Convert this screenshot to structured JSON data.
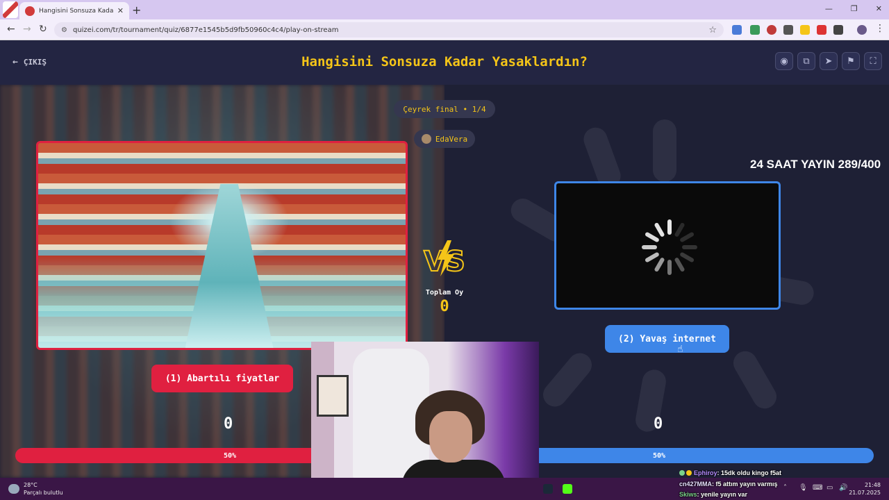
{
  "browser": {
    "tab_title": "Hangisini Sonsuza Kadar Yasaklardın",
    "url": "quizei.com/tr/tournament/quiz/6877e1545b5d9fb50960c4c4/play-on-stream"
  },
  "header": {
    "exit_label": "ÇIKIŞ",
    "title": "Hangisini Sonsuza Kadar Yasaklardın?"
  },
  "stage": {
    "round_label": "Çeyrek final • 1/4",
    "creator": "EdaVera",
    "total_votes_label": "Toplam Oy",
    "total_votes": "0",
    "stream_title": "24 SAAT YAYIN 289/400"
  },
  "options": [
    {
      "label": "(1) Abartılı fiyatlar",
      "votes": "0",
      "percent_label": "50%",
      "percent": 50,
      "color": "#e02040"
    },
    {
      "label": "(2) Yavaş internet",
      "votes": "0",
      "percent_label": "50%",
      "percent": 50,
      "color": "#3e86e8"
    }
  ],
  "taskbar": {
    "temperature": "28°C",
    "weather": "Parçalı bulutlu",
    "time": "21:48",
    "date": "21.07.2025"
  },
  "chat": [
    {
      "user": "Ephiroy",
      "message": ": 15dk oldu kingo f5at"
    },
    {
      "user": "cn427MMA",
      "message": ": f5 attım yayın varmış"
    },
    {
      "user": "Skiws",
      "message": ": yenile yayın var"
    }
  ],
  "colors": {
    "accent": "#f5c518",
    "red": "#e02040",
    "blue": "#3e86e8",
    "bg": "#1d1e33"
  }
}
